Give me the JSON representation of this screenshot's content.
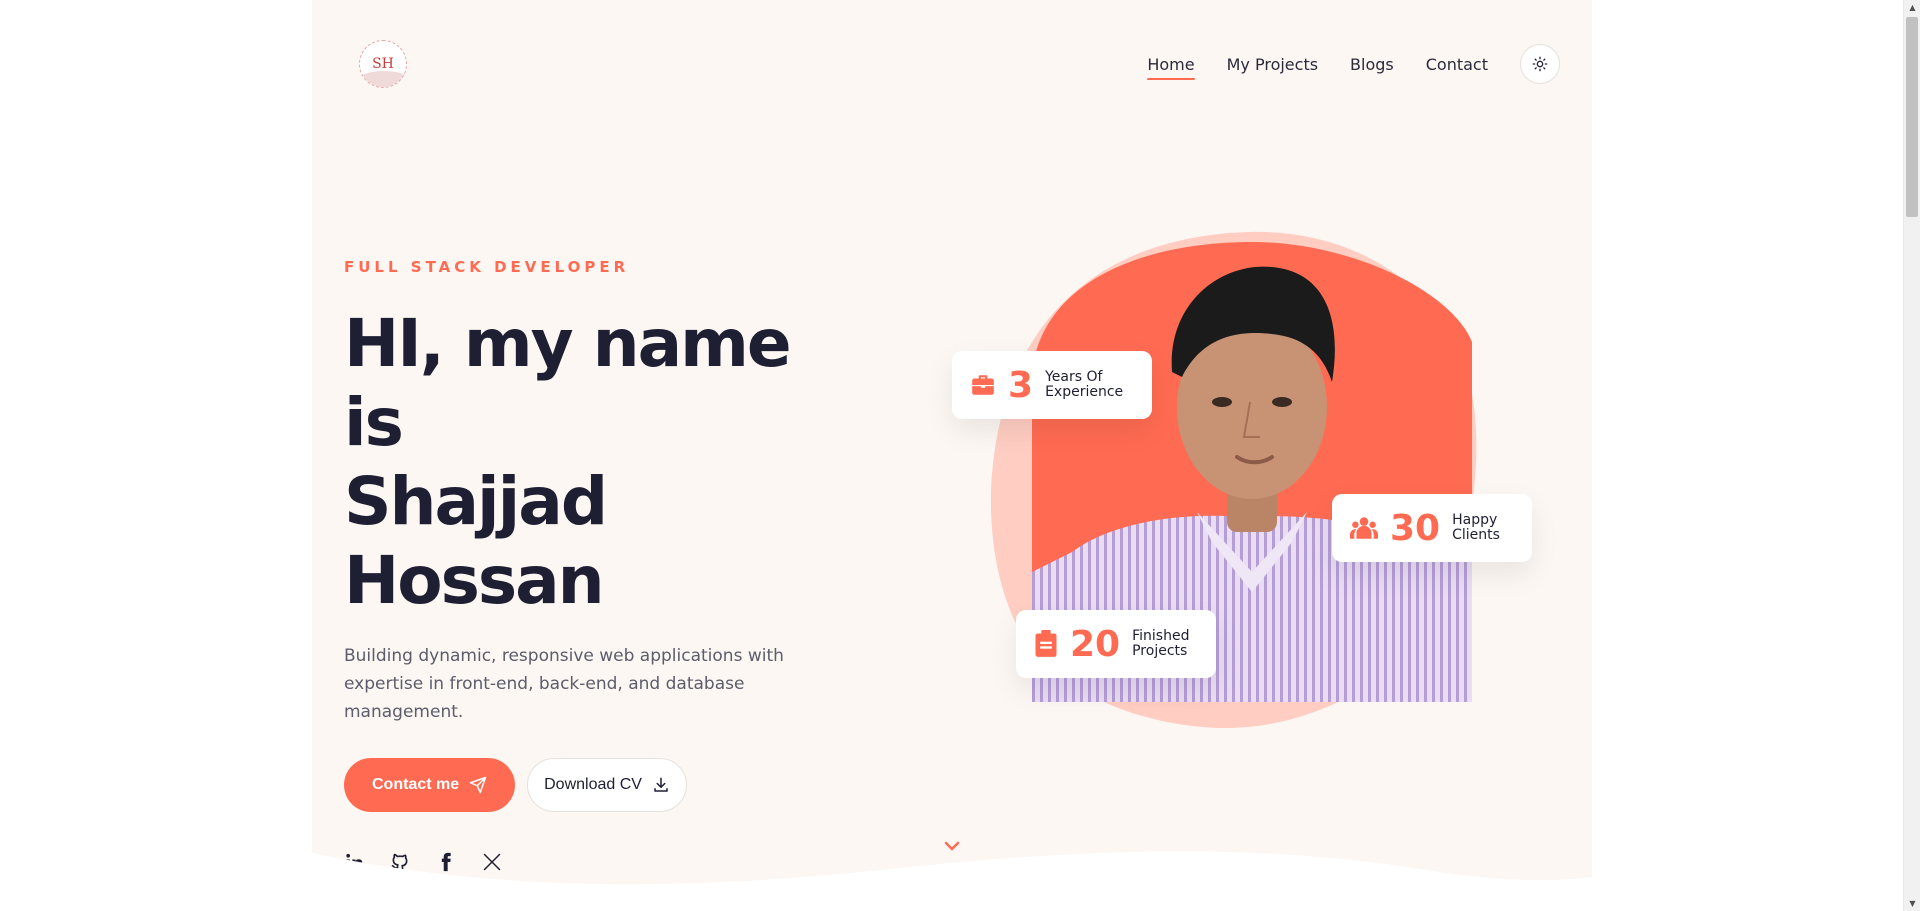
{
  "logo": {
    "monogram": "SH"
  },
  "nav": {
    "items": [
      {
        "label": "Home",
        "active": true
      },
      {
        "label": "My Projects",
        "active": false
      },
      {
        "label": "Blogs",
        "active": false
      },
      {
        "label": "Contact",
        "active": false
      }
    ],
    "theme_toggle_icon": "sun-icon"
  },
  "hero": {
    "eyebrow": "FULL STACK DEVELOPER",
    "title_line1": "HI, my name is",
    "title_line2": "Shajjad Hossan",
    "description": "Building dynamic, responsive web applications with expertise in front-end, back-end, and database management.",
    "primary_cta": "Contact me",
    "secondary_cta": "Download CV",
    "socials": [
      "linkedin-icon",
      "github-icon",
      "facebook-icon",
      "x-icon"
    ]
  },
  "stats": [
    {
      "number": "3",
      "label_line1": "Years Of",
      "label_line2": "Experience",
      "icon": "briefcase-icon"
    },
    {
      "number": "30",
      "label_line1": "Happy",
      "label_line2": "Clients",
      "icon": "users-icon"
    },
    {
      "number": "20",
      "label_line1": "Finished",
      "label_line2": "Projects",
      "icon": "document-icon"
    }
  ],
  "colors": {
    "accent": "#ff6b52",
    "accent_light": "#ffcdc2",
    "page_bg": "#fcf7f3",
    "heading": "#1f1f33"
  }
}
